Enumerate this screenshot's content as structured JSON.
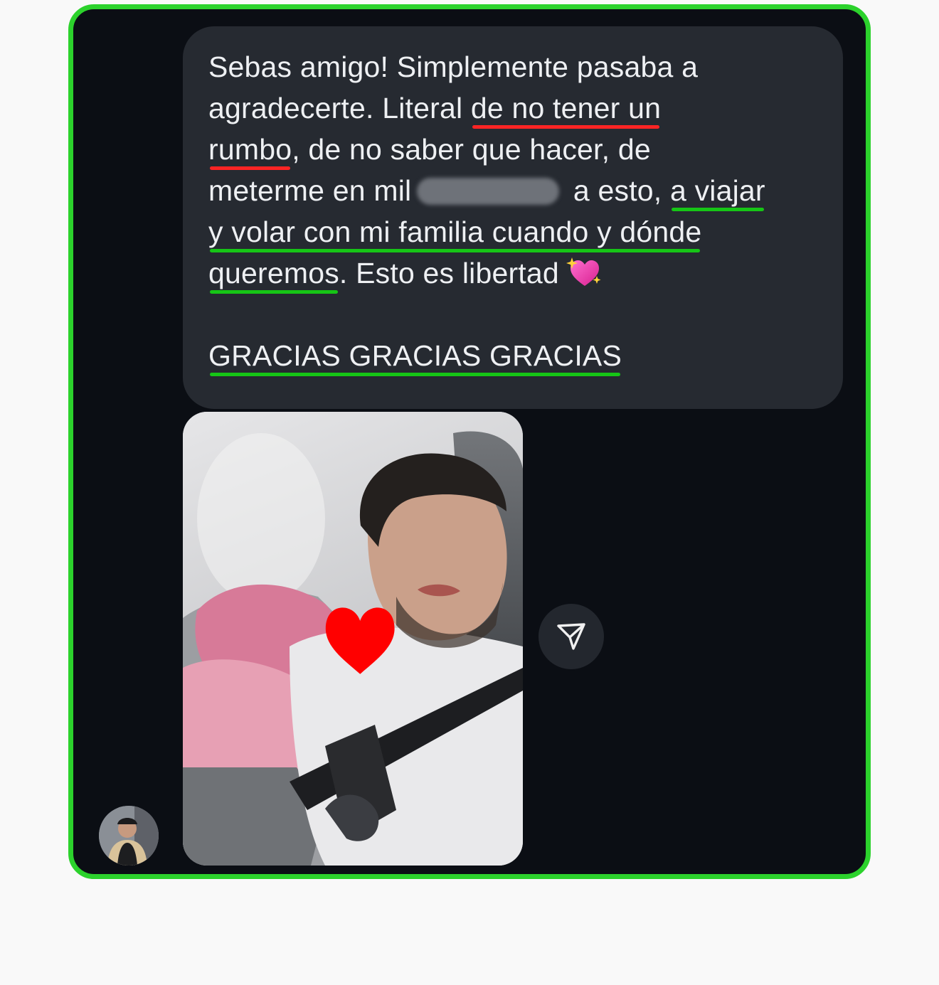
{
  "message": {
    "line1": "Sebas amigo! Simplemente pasaba a",
    "line2_a": "agradecerte. Literal ",
    "line2_b": "de no tener un",
    "line3_a": "rumbo",
    "line3_b": ", de no saber que hacer, de",
    "line4_a": "meterme en mil",
    "line4_b": " a esto, ",
    "line4_c": "a viajar",
    "line5": "y volar con mi familia cuando y dónde",
    "line6_a": "queremos",
    "line6_b": ". Esto es libertad",
    "emoji": "sparkling-heart-emoji",
    "closing": "GRACIAS GRACIAS GRACIAS"
  },
  "colors": {
    "frame_border": "#2cd22c",
    "background": "#0b0e14",
    "bubble": "#262a31",
    "underline_red": "#ff2424",
    "underline_green": "#16c516"
  },
  "attachment": {
    "type": "photo",
    "overlay": "heart-sticker"
  },
  "actions": {
    "share_icon": "send-icon"
  }
}
